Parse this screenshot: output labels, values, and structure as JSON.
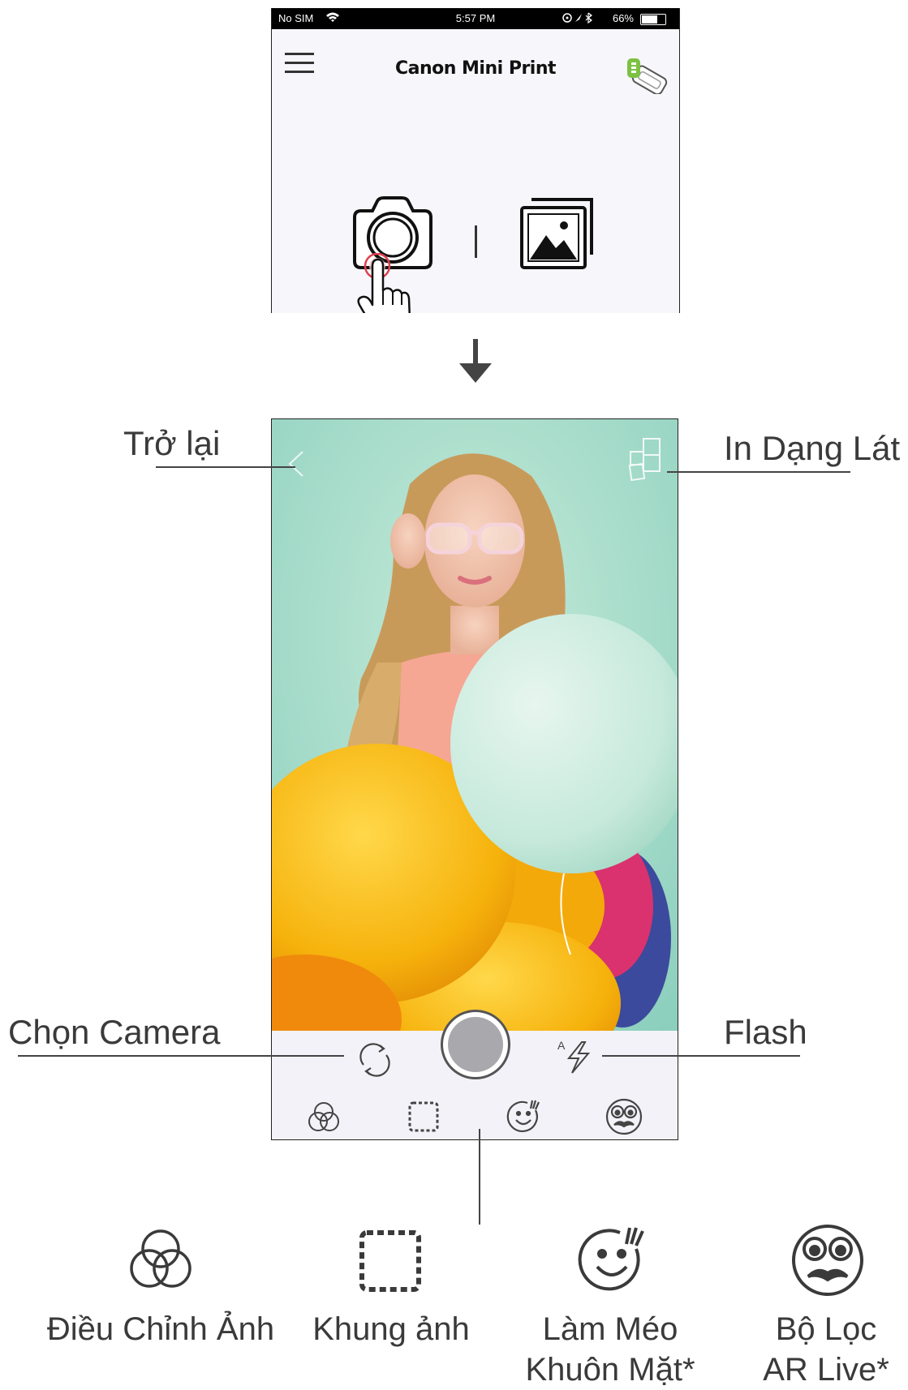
{
  "status_bar": {
    "carrier": "No SIM",
    "time": "5:57 PM",
    "battery": "66%"
  },
  "top_screen": {
    "title": "Canon Mini Print"
  },
  "callouts": {
    "back": "Trở lại",
    "tile_print": "In Dạng Lát",
    "camera_select": "Chọn Camera",
    "flash": "Flash"
  },
  "flash_mode_label": "A",
  "legend": [
    {
      "label": "Điều Chỉnh Ảnh",
      "icon": "adjust-rings-icon"
    },
    {
      "label": "Khung ảnh",
      "icon": "frame-icon"
    },
    {
      "label": "Làm Méo\nKhuôn Mặt*",
      "icon": "face-warp-icon"
    },
    {
      "label": "Bộ Lọc\nAR Live*",
      "icon": "ar-filter-icon"
    }
  ],
  "colors": {
    "background": "#ffffff",
    "photo_bg": "#a8dccc",
    "balloon_yellow": "#f5b60d",
    "balloon_mint": "#c9ebe0",
    "toolbar": "#f2f2f8",
    "text": "#3a3a3a",
    "printer_battery": "#7cc242",
    "touch_ring": "#e0414d"
  }
}
